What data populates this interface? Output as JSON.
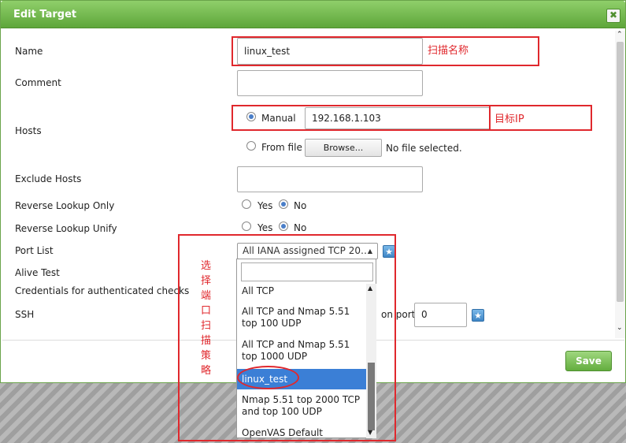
{
  "dialog": {
    "title": "Edit Target",
    "close": "✖"
  },
  "form": {
    "name_label": "Name",
    "name_value": "linux_test",
    "comment_label": "Comment",
    "comment_value": "",
    "hosts_label": "Hosts",
    "hosts_manual_label": "Manual",
    "hosts_manual_value": "192.168.1.103",
    "hosts_file_label": "From file",
    "browse_label": "Browse...",
    "no_file_label": "No file selected.",
    "exclude_label": "Exclude Hosts",
    "exclude_value": "",
    "rlo_label": "Reverse Lookup Only",
    "rlu_label": "Reverse Lookup Unify",
    "yes": "Yes",
    "no": "No",
    "port_list_label": "Port List",
    "port_list_selected": "All IANA assigned TCP 20…",
    "alive_label": "Alive Test",
    "creds_label": "Credentials for authenticated checks",
    "ssh_label": "SSH",
    "on_port_label": "on port",
    "ssh_port": "0",
    "save_label": "Save"
  },
  "dropdown": {
    "options": [
      "All TCP",
      "All TCP and Nmap 5.51 top 100 UDP",
      "All TCP and Nmap 5.51 top 1000 UDP",
      "linux_test",
      "Nmap 5.51 top 2000 TCP and top 100 UDP",
      "OpenVAS Default"
    ],
    "selected_index": 3
  },
  "annotations": {
    "scan_name": "扫描名称",
    "target_ip": "目标IP",
    "port_policy": "选择端口扫描策略"
  },
  "colors": {
    "accent_green": "#5ea63a",
    "annotation_red": "#e0282d",
    "select_blue": "#3b7fd6"
  }
}
